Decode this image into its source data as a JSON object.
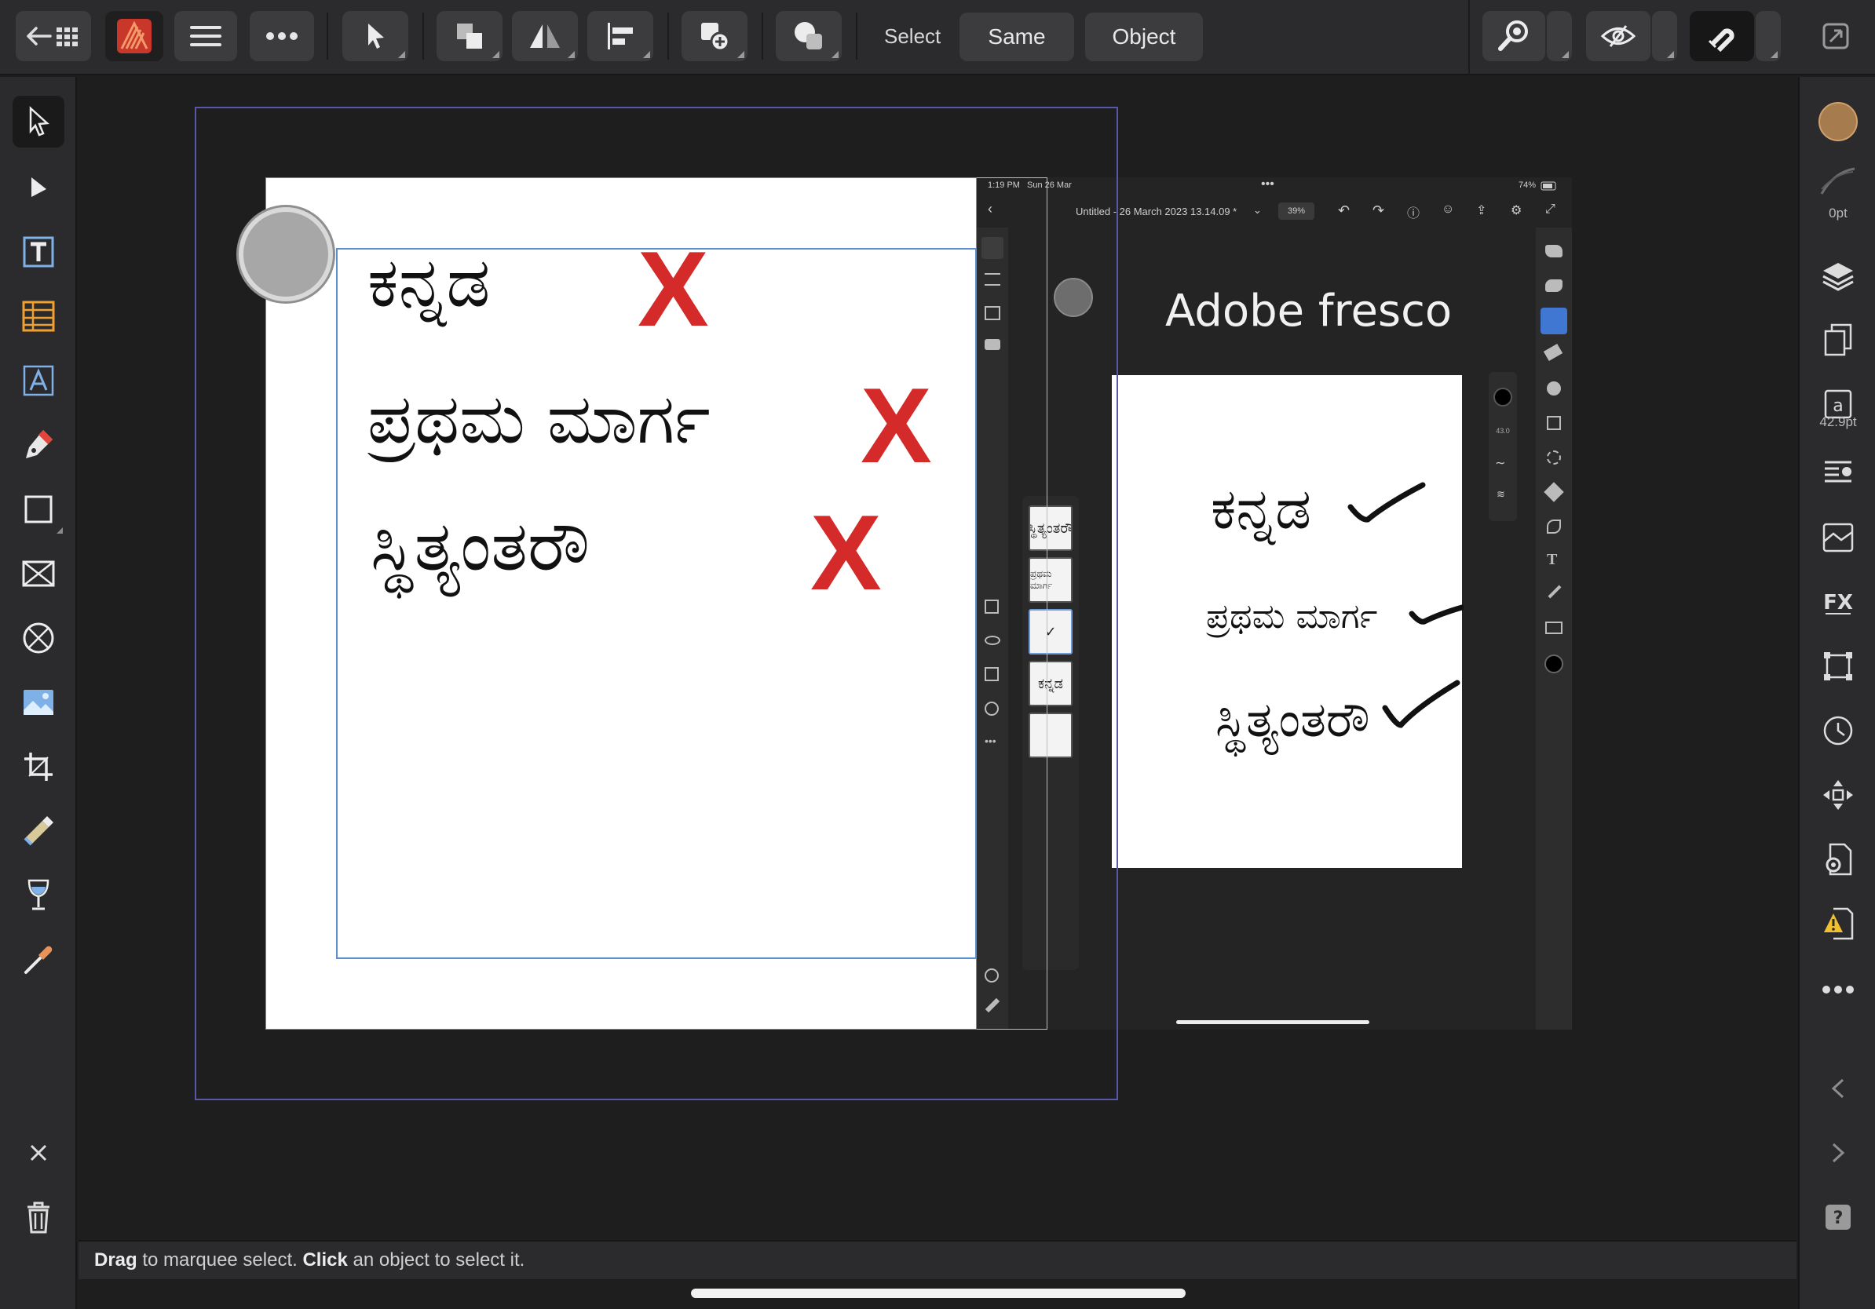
{
  "toolbar": {
    "select_label": "Select",
    "same_label": "Same",
    "object_label": "Object"
  },
  "document": {
    "lines": [
      "ಕನ್ನಡ",
      "ಪ್ರಥಮ ಮಾರ್ಗ",
      "ಸ್ಥಿತ್ಯಂತರೌ"
    ],
    "mark": "X",
    "mark_color": "#d42a2a"
  },
  "embedded_screenshot": {
    "status_time": "1:19 PM",
    "status_date": "Sun 26 Mar",
    "battery": "74%",
    "doc_title": "Untitled - 26 March 2023 13.14.09 *",
    "zoom": "39%",
    "brush_size": "43.0",
    "heading": "Adobe fresco",
    "canvas_lines": [
      "ಕನ್ನಡ",
      "ಪ್ರಥಮ ಮಾರ್ಗ",
      "ಸ್ಥಿತ್ಯಂತರೌ"
    ],
    "layer_thumbs": [
      "ಸ್ಥಿತ್ಯಂತರೌ",
      "ಪ್ರಥಮ ಮಾರ್ಗ",
      "✓",
      "ಕನ್ನಡ",
      ""
    ]
  },
  "right_studio": {
    "stroke_width": "0pt",
    "font_size": "42.9pt",
    "fill_color": "#a67c4e"
  },
  "statusbar": {
    "drag": "Drag",
    "drag_rest": " to marquee select. ",
    "click": "Click",
    "click_rest": " an object to select it."
  },
  "accent": "#5b8fd4"
}
